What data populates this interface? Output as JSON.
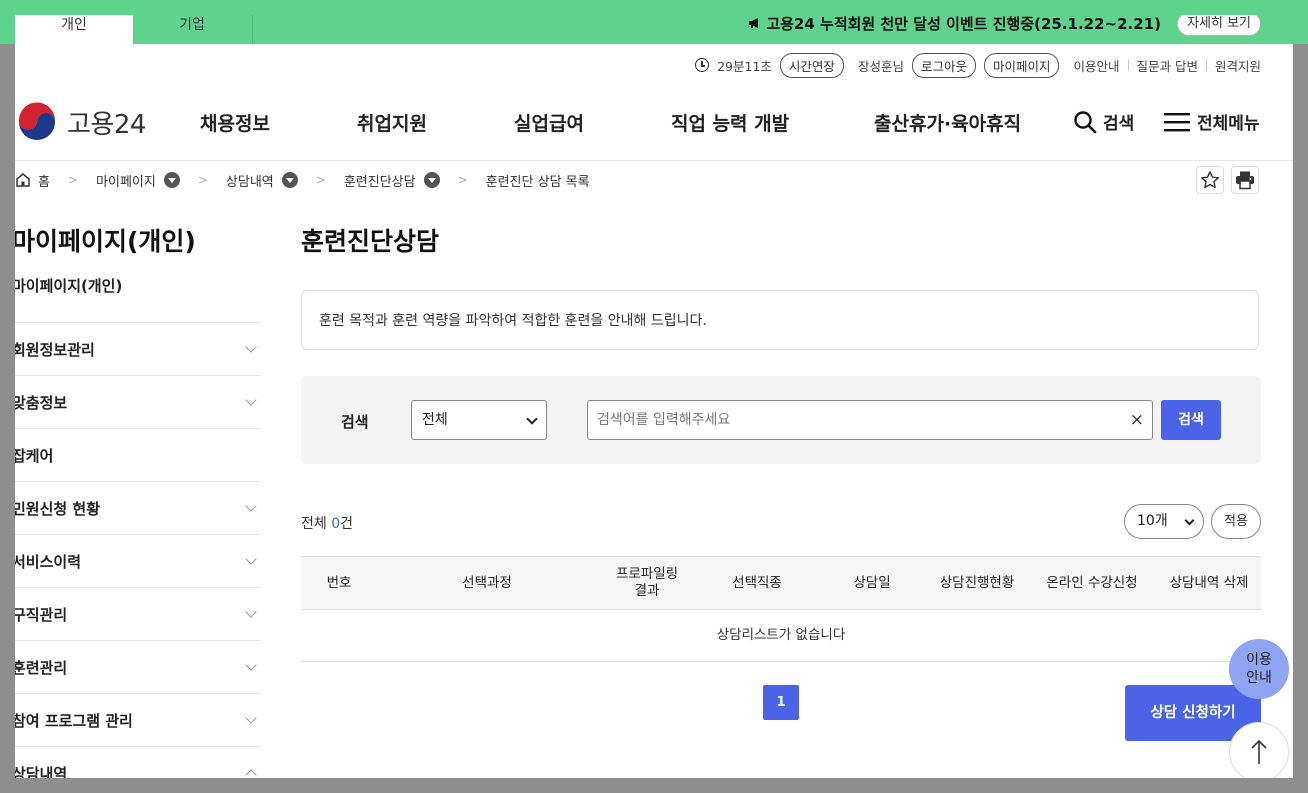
{
  "top_tabs": [
    {
      "label": "개인",
      "active": true
    },
    {
      "label": "기업",
      "active": false
    }
  ],
  "notice": {
    "icon": "megaphone-icon",
    "text": "고용24 누적회원 천만 달성 이벤트 진행중(25.1.22~2.21)",
    "detail_button": "자세히 보기"
  },
  "utility": {
    "timer": "29분11초",
    "extend_button": "시간연장",
    "user_name": "장성훈님",
    "logout_button": "로그아웃",
    "mypage_button": "마이페이지",
    "links": [
      "이용안내",
      "질문과 답변",
      "원격지원"
    ]
  },
  "logo": {
    "text": "고용24"
  },
  "gnb": [
    "채용정보",
    "취업지원",
    "실업급여",
    "직업 능력 개발",
    "출산휴가·육아휴직"
  ],
  "header_right": {
    "search_label": "검색",
    "menu_label": "전체메뉴"
  },
  "breadcrumb": {
    "home": "홈",
    "items": [
      "마이페이지",
      "상담내역",
      "훈련진단상담"
    ],
    "current": "훈련진단 상담 목록"
  },
  "sidebar": {
    "title": "마이페이지(개인)",
    "items": [
      {
        "label": "마이페이지(개인)",
        "expandable": false
      },
      {
        "label": "회원정보관리",
        "expandable": true
      },
      {
        "label": "맞춤정보",
        "expandable": true
      },
      {
        "label": "잡케어",
        "expandable": false
      },
      {
        "label": "민원신청 현황",
        "expandable": true
      },
      {
        "label": "서비스이력",
        "expandable": true
      },
      {
        "label": "구직관리",
        "expandable": true
      },
      {
        "label": "훈련관리",
        "expandable": true
      },
      {
        "label": "참여 프로그램 관리",
        "expandable": true
      },
      {
        "label": "상담내역",
        "expandable": true,
        "expanded": true
      }
    ]
  },
  "main": {
    "title": "훈련진단상담",
    "info_text": "훈련 목적과 훈련 역량을 파악하여 적합한 훈련을 안내해 드립니다.",
    "search": {
      "label": "검색",
      "select_value": "전체",
      "input_placeholder": "검색어를 입력해주세요",
      "clear_symbol": "×",
      "button": "검색"
    },
    "total_label": "전체",
    "total_count": "0",
    "total_unit": "건",
    "per_page": "10개",
    "apply_button": "적용",
    "table": {
      "headers": [
        "번호",
        "선택과정",
        "프로파일링\n결과",
        "선택직종",
        "상담일",
        "상담진행현황",
        "온라인 수강신청",
        "상담내역 삭제"
      ],
      "empty_text": "상담리스트가 없습니다"
    },
    "pagination": {
      "current": "1"
    },
    "consult_button": "상담 신청하기"
  },
  "floating": {
    "help": "이용\n안내",
    "top_icon": "arrow-up-icon"
  }
}
